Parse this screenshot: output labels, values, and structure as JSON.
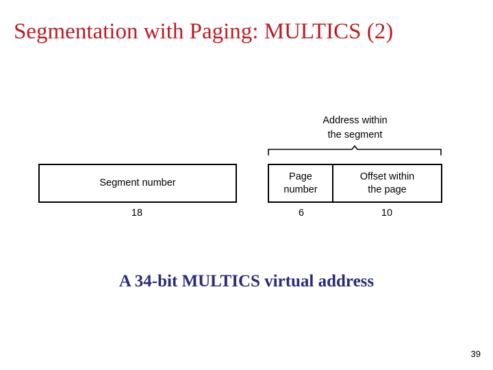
{
  "slide": {
    "title": "Segmentation with Paging: MULTICS (2)",
    "title_color": "#bd1b22",
    "page_number": "39",
    "background_color": "#ffffff"
  },
  "diagram": {
    "caption": "A 34-bit MULTICS virtual address",
    "caption_color": "#2a2a7a",
    "brace_label_line1": "Address within",
    "brace_label_line2": "the segment",
    "fields": [
      {
        "label": "Segment number",
        "bits": "18"
      },
      {
        "label_line1": "Page",
        "label_line2": "number",
        "bits": "6"
      },
      {
        "label_line1": "Offset within",
        "label_line2": "the page",
        "bits": "10"
      }
    ]
  }
}
